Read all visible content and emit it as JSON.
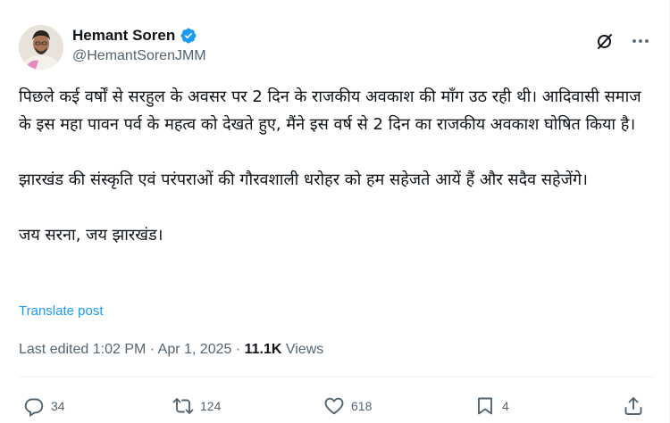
{
  "author": {
    "display_name": "Hemant Soren",
    "handle": "@HemantSorenJMM",
    "verified_icon": "verified-badge-icon",
    "verified_color": "#1d9bf0"
  },
  "post": {
    "paragraphs": [
      "पिछले कई वर्षों से सरहुल के अवसर पर 2 दिन के राजकीय अवकाश की माँग उठ रही थी। आदिवासी समाज के इस महा पावन पर्व के महत्व को देखते हुए, मैंने इस वर्ष से 2 दिन का राजकीय अवकाश घोषित किया है।",
      "झारखंड की संस्कृति एवं परंपराओं की गौरवशाली धरोहर को हम सहेजते आयें हैं और सदैव सहेजेंगे।",
      "जय सरना, जय झारखंड।"
    ],
    "translate_label": "Translate post",
    "edited_label": "Last edited 1:02 PM",
    "separator": "·",
    "date": "Apr 1, 2025",
    "views_count": "11.1K",
    "views_label": "Views"
  },
  "actions": {
    "replies": "34",
    "reposts": "124",
    "likes": "618",
    "bookmarks": "4"
  },
  "colors": {
    "text": "#0f1419",
    "secondary": "#536471",
    "accent": "#1d9bf0",
    "divider": "#eff3f4"
  }
}
